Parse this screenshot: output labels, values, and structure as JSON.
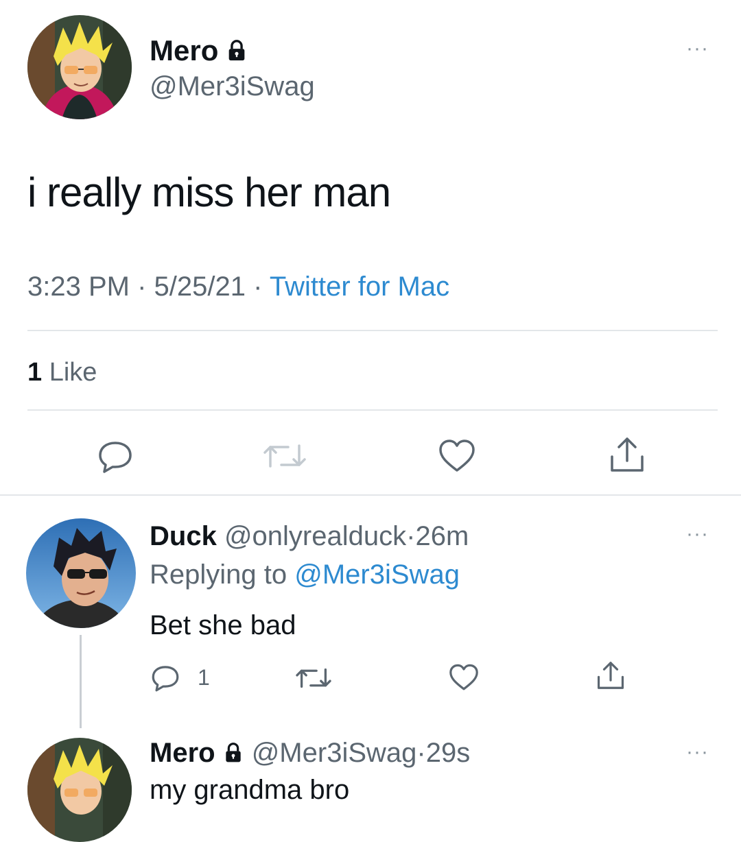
{
  "main_tweet": {
    "name": "Mero",
    "handle": "@Mer3iSwag",
    "text": "i really miss her man",
    "time": "3:23 PM",
    "date": "5/25/21",
    "separator": "·",
    "source": "Twitter for Mac",
    "likes_count": "1",
    "likes_label": "Like",
    "more_label": "···"
  },
  "reply1": {
    "name": "Duck",
    "handle": "@onlyrealduck",
    "time": "26m",
    "separator": "·",
    "replying_label": "Replying to",
    "replying_handle": "@Mer3iSwag",
    "text": "Bet she bad",
    "reply_count": "1",
    "more_label": "···"
  },
  "reply2": {
    "name": "Mero",
    "handle": "@Mer3iSwag",
    "time": "29s",
    "separator": "·",
    "text": "my grandma bro",
    "more_label": "···"
  },
  "icons": {
    "reply": "reply-icon",
    "retweet": "retweet-icon",
    "like": "heart-icon",
    "share": "share-icon",
    "lock": "lock-icon",
    "more": "more-icon"
  },
  "colors": {
    "link": "#2d8ad0",
    "secondary_text": "#5b6670",
    "primary_text": "#0f1419"
  }
}
